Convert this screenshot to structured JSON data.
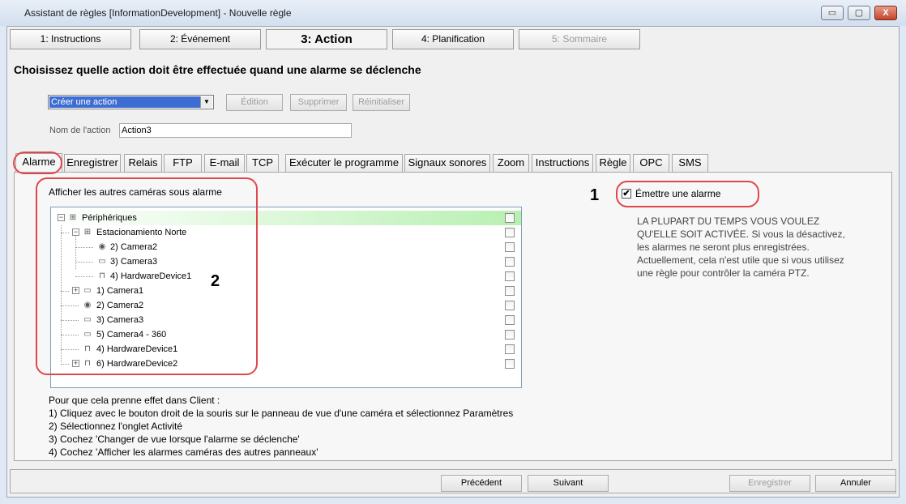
{
  "window": {
    "title": "Assistant de règles [InformationDevelopment] - Nouvelle règle",
    "minimize": "▭",
    "maximize": "▢",
    "close": "X"
  },
  "steps": [
    {
      "label": "1: Instructions"
    },
    {
      "label": "2: Événement"
    },
    {
      "label": "3: Action"
    },
    {
      "label": "4: Planification"
    },
    {
      "label": "5: Sommaire"
    }
  ],
  "page_title": "Choisissez quelle action doit être effectuée quand une alarme se déclenche",
  "action_select": {
    "value": "Créer une action",
    "arrow": "▼"
  },
  "action_buttons": {
    "edit": "Édition",
    "delete": "Supprimer",
    "reset": "Réinitialiser"
  },
  "action_name": {
    "label": "Nom de l'action",
    "value": "Action3"
  },
  "tabs": [
    "Alarme",
    "Enregistrer",
    "Relais",
    "FTP",
    "E-mail",
    "TCP",
    "Exécuter le programme",
    "Signaux sonores",
    "Zoom",
    "Instructions",
    "Règle",
    "OPC",
    "SMS"
  ],
  "alarm_panel": {
    "cameras_heading": "Afficher les autres caméras sous alarme",
    "tree": [
      {
        "label": "Périphériques",
        "icon": "network-icon"
      },
      {
        "label": "Estacionamiento Norte",
        "icon": "network-icon"
      },
      {
        "label": "2) Camera2",
        "icon": "dome-camera-icon"
      },
      {
        "label": "3) Camera3",
        "icon": "camera-icon"
      },
      {
        "label": "4) HardwareDevice1",
        "icon": "device-icon"
      },
      {
        "label": "1) Camera1",
        "icon": "camera-icon"
      },
      {
        "label": "2) Camera2",
        "icon": "dome-camera-icon"
      },
      {
        "label": "3) Camera3",
        "icon": "camera-icon"
      },
      {
        "label": "5) Camera4 - 360",
        "icon": "camera-icon"
      },
      {
        "label": "4) HardwareDevice1",
        "icon": "device-icon"
      },
      {
        "label": "6) HardwareDevice2",
        "icon": "device-icon"
      }
    ],
    "emit_alarm": {
      "label": "Émettre une alarme",
      "checked": true,
      "mark": "✔"
    },
    "info": "LA PLUPART DU TEMPS VOUS VOULEZ QU'ELLE SOIT ACTIVÉE.  Si vous la désactivez, les alarmes ne seront plus enregistrées.  Actuellement, cela n'est utile que si vous utilisez une règle pour contrôler la caméra PTZ.",
    "instructions": [
      "Pour que cela prenne effet dans  Client :",
      "1) Cliquez avec le bouton droit de la souris sur le panneau de vue d'une caméra et sélectionnez Paramètres",
      "2) Sélectionnez l'onglet Activité",
      "3) Cochez 'Changer de vue lorsque l'alarme se déclenche'",
      "4) Cochez 'Afficher les alarmes caméras des autres panneaux'"
    ]
  },
  "callouts": {
    "one": "1",
    "two": "2"
  },
  "tree_glyphs": {
    "expand": "+",
    "collapse": "−"
  },
  "icon_glyphs": {
    "network": "⊞",
    "camera": "▭",
    "dome": "◉",
    "device": "⊓"
  },
  "footer": {
    "previous": "Précédent",
    "next": "Suivant",
    "save": "Enregistrer",
    "cancel": "Annuler"
  },
  "colors": {
    "accent": "#3d6cd2",
    "callout": "#e0474c",
    "highlight": "#b8f0b2"
  }
}
